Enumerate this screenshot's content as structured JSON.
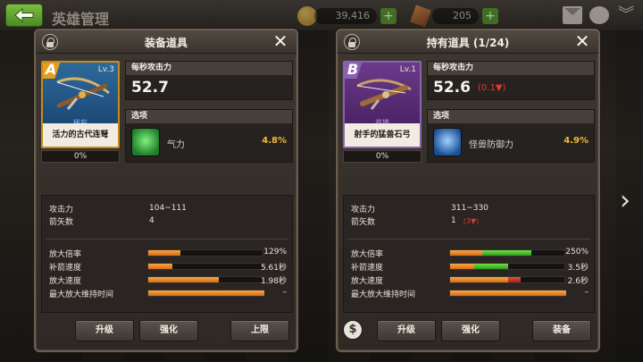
{
  "header": {
    "title": "英雄管理",
    "gold": "39,416",
    "gems": "205",
    "plus": "+"
  },
  "panels": [
    {
      "title": "装备道具",
      "item": {
        "grade": "A",
        "level": "Lv.3",
        "rarity": "稀有",
        "name": "活力的古代连弩",
        "progress": "0%"
      },
      "dps": {
        "label": "每秒攻击力",
        "value": "52.7",
        "delta": ""
      },
      "option": {
        "label": "选项",
        "name": "气力",
        "value": "4.8%",
        "icon": "green-face-icon"
      },
      "stats": [
        {
          "label": "攻击力",
          "value": "104~111",
          "diff": ""
        },
        {
          "label": "箭矢数",
          "value": "4",
          "diff": ""
        }
      ],
      "bars": [
        {
          "label": "放大倍率",
          "value": "129%",
          "fill": 0.28,
          "green": 0,
          "red": 0
        },
        {
          "label": "补箭速度",
          "value": "5.61秒",
          "fill": 0.21,
          "green": 0,
          "red": 0
        },
        {
          "label": "放大速度",
          "value": "1.98秒",
          "fill": 0.61,
          "green": 0,
          "red": 0
        },
        {
          "label": "最大放大维持时间",
          "value": "–",
          "fill": 1.0,
          "green": 0,
          "red": 0
        }
      ],
      "buttons": [
        "升级",
        "强化",
        "上限"
      ]
    },
    {
      "title": "持有道具 (1/24)",
      "item": {
        "grade": "B",
        "level": "Lv.1",
        "rarity": "英雄",
        "name": "射手的猛兽石弓",
        "progress": "0%"
      },
      "dps": {
        "label": "每秒攻击力",
        "value": "52.6",
        "delta": "(0.1▼)"
      },
      "option": {
        "label": "选项",
        "name": "怪兽防御力",
        "value": "4.9%",
        "icon": "blue-shield-icon"
      },
      "stats": [
        {
          "label": "攻击力",
          "value": "311~330",
          "diff": ""
        },
        {
          "label": "箭矢数",
          "value": "1",
          "diff": "(3▼)"
        }
      ],
      "bars": [
        {
          "label": "放大倍率",
          "value": "250%",
          "fill": 0.28,
          "green": 0.42,
          "red": 0
        },
        {
          "label": "补箭速度",
          "value": "3.5秒",
          "fill": 0.21,
          "green": 0.29,
          "red": 0
        },
        {
          "label": "放大速度",
          "value": "2.6秒",
          "fill": 0.5,
          "green": 0,
          "red": 0.11
        },
        {
          "label": "最大放大维持时间",
          "value": "–",
          "fill": 1.0,
          "green": 0,
          "red": 0
        }
      ],
      "buttons": [
        "升级",
        "强化",
        "装备"
      ]
    }
  ]
}
